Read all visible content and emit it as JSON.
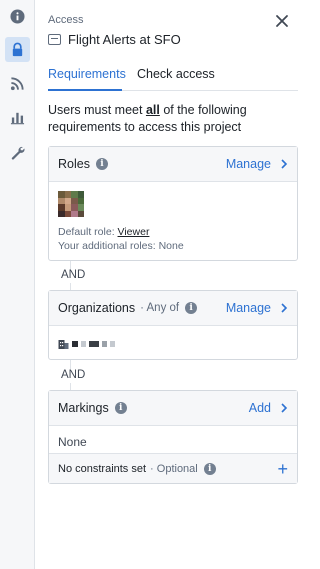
{
  "sidebar": {
    "items": [
      {
        "name": "info",
        "icon": "info-icon"
      },
      {
        "name": "access",
        "icon": "lock-icon",
        "active": true
      },
      {
        "name": "feed",
        "icon": "rss-icon"
      },
      {
        "name": "stats",
        "icon": "bar-chart-icon"
      },
      {
        "name": "settings",
        "icon": "wrench-icon"
      }
    ]
  },
  "header": {
    "crumb": "Access",
    "title": "Flight Alerts at SFO"
  },
  "tabs": [
    {
      "label": "Requirements",
      "active": true
    },
    {
      "label": "Check access",
      "active": false
    }
  ],
  "intro": {
    "before": "Users must meet ",
    "emph": "all",
    "after": " of the following requirements to access this project"
  },
  "roles": {
    "title": "Roles",
    "action": "Manage",
    "default_prefix": "Default role: ",
    "default_value": "Viewer",
    "additional": "Your additional roles: None"
  },
  "and_label": "AND",
  "organizations": {
    "title": "Organizations",
    "qualifier": "· Any of",
    "action": "Manage"
  },
  "markings": {
    "title": "Markings",
    "action": "Add",
    "value": "None",
    "footer_text": "No constraints set",
    "footer_optional": "· Optional"
  },
  "colors": {
    "accent": "#2d72d2",
    "rail_bg": "#f6f7f9",
    "active_bg": "#d3e2f5"
  }
}
